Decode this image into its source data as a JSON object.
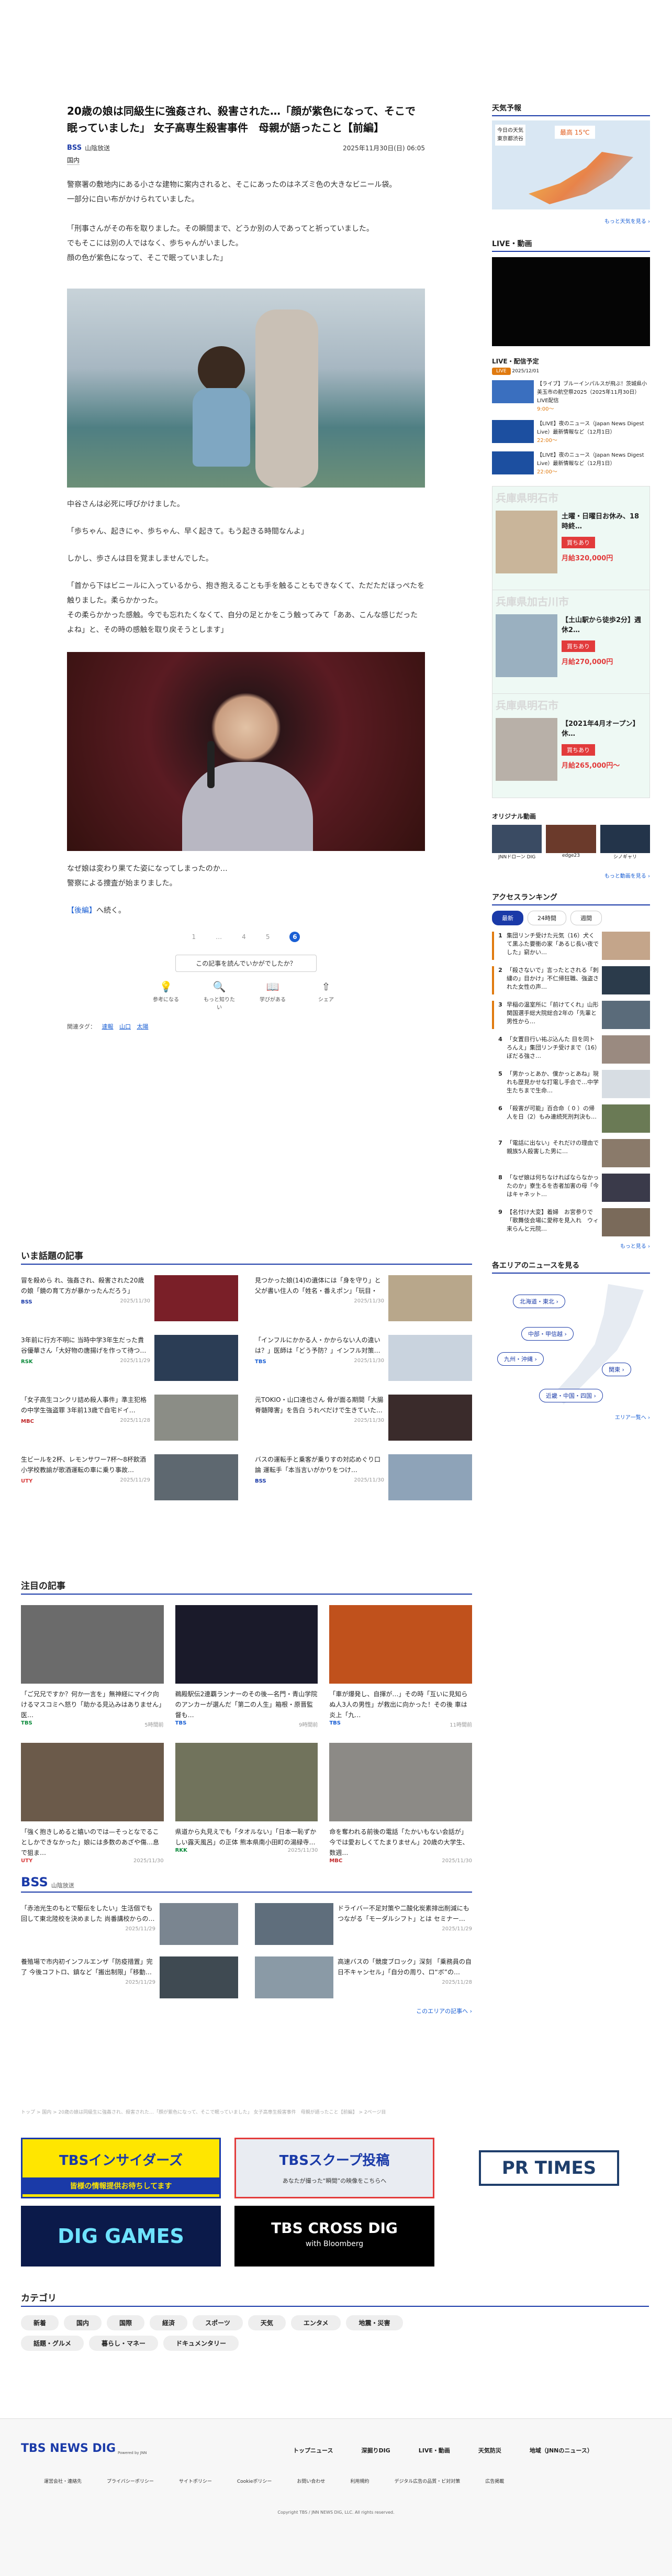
{
  "article": {
    "title": "20歳の娘は同級生に強姦され、殺害された…「顔が紫色になって、そこで眠っていました」 女子高専生殺害事件　母親が語ったこと【前編】",
    "source": "BSS",
    "source_name": "山陰放送",
    "datetime": "2025年11月30日(日) 06:05",
    "category": "国内",
    "p1": "警察署の敷地内にある小さな建物に案内されると、そこにあったのはネズミ色の大きなビニール袋。",
    "p2": "一部分に白い布がかけられていました。",
    "p3": "「刑事さんがその布を取りました。その瞬間まで、どうか別の人であってと祈っていました。",
    "p4": "でもそこには別の人ではなく、歩ちゃんがいました。",
    "p5": "顔の色が紫色になって、そこで眠っていました」",
    "caption": "中谷さんは必死に呼びかけました。",
    "p6": "「歩ちゃん、起きにゃ、歩ちゃん、早く起きて。もう起きる時間なんよ」",
    "p7": "しかし、歩さんは目を覚ましませんでした。",
    "p8": "「首から下はビニールに入っているから、抱き抱えることも手を触ることもできなくて、ただただほっぺたを触りました。柔らかかった。",
    "p9": "その柔らかかった感触。今でも忘れたくなくて、自分の足とかをこう触ってみて「ああ、こんな感じだったよね」と、その時の感触を取り戻そうとします」",
    "p10": "なぜ娘は変わり果てた姿になってしまったのか…",
    "p11": "警察による捜査が始まりました。",
    "next_link": "【後編】",
    "next_text": "へ続く。",
    "pages": [
      "1",
      "…",
      "4",
      "5",
      "6"
    ],
    "react_prompt": "この記事を読んでいかがでしたか？",
    "reactions": [
      {
        "icon": "bulb-icon",
        "label": "参考になる",
        "glyph": "💡"
      },
      {
        "icon": "search-icon",
        "label": "もっと知りたい",
        "glyph": "🔍"
      },
      {
        "icon": "book-icon",
        "label": "学びがある",
        "glyph": "📖"
      },
      {
        "icon": "share-icon",
        "label": "シェア",
        "glyph": "⇧"
      }
    ],
    "tags_label": "関連タグ：",
    "tags": [
      "速報",
      "山口",
      "太陽"
    ]
  },
  "sections": {
    "trending": "いま話題の記事",
    "notable": "注目の記事",
    "bss_label": "山陰放送",
    "bss_more": "このエリアの記事へ ›",
    "breadcrumb": "トップ > 国内 > 20歳の娘は同級生に強姦され、殺害された…「顔が紫色になって、そこで眠っていました」 女子高専生殺害事件　母親が語ったこと【前編】 > 2ページ目",
    "categories_title": "カテゴリ"
  },
  "trending": [
    {
      "text": "冒を殺めら れ、強姦され、殺害された20歳の娘「鏡の育て方が暴かったんだろう」",
      "src": "BSS",
      "date": "2025/11/30",
      "c": "#7a1f28"
    },
    {
      "text": "見つかった娘(14)の遺体には「身を守り」と父が書い住人の「姓名・番えポン」「玩目・",
      "src": "",
      "date": "2025/11/30",
      "c": "#b8a78b"
    },
    {
      "text": "3年前に行方不明に 当時中学3年生だった貴谷優華さん「大好物の唐揚げを作って待つ…",
      "src": "RSK",
      "date": "2025/11/29",
      "c": "#2b3d55"
    },
    {
      "text": "「インフルにかかる人・かからない人の違いは？」医師は「どう予防？」インフル対策…",
      "src": "TBS",
      "date": "2025/11/30",
      "c": "#c9d3de"
    },
    {
      "text": "「女子高生コンクリ詰め殺人事件」準主犯格の中学生強盗罪 3年前13歳で自宅ドイ…",
      "src": "MBC",
      "date": "2025/11/28",
      "c": "#8b8d86"
    },
    {
      "text": "元TOKIO・山口達也さん 骨が面る期間「大腸脊髄障害」を告白 うれべだけで生きていた…",
      "src": "",
      "date": "2025/11/30",
      "c": "#3a2b2b"
    },
    {
      "text": "生ビールを2杯、レモンサワー7杯〜8杯飲酒 小学校教諭が歌酒運転の車に乗り事故…",
      "src": "UTY",
      "date": "2025/11/29",
      "c": "#5e6870"
    },
    {
      "text": "バスの運転手と乗客が乗りすの対応めぐり口論 運転手「本当言いがかりをつけ…",
      "src": "BSS",
      "date": "2025/11/30",
      "c": "#8ea3b8"
    }
  ],
  "notable": [
    {
      "text": "「ご兄兄ですか？何か一言を」無神経にマイク向けるマスコミへ怒り「助かる見込みはありません」医…",
      "src": "TBS",
      "date": "5時間前",
      "c": "#6b6b6b"
    },
    {
      "text": "鵜殿駅伝2連覇ランナーのその後—名門・青山学院のアンカーが選んだ「第二の人生」箱根・原晋監督も…",
      "src": "TBS",
      "date": "9時間前",
      "c": "#1a1a2a"
    },
    {
      "text": "「車が爆発し、自揮が…」その時「互いに見知らぬ人3人の男性」が救出に向かった！その後 車は炎上「九…",
      "src": "TBS",
      "date": "11時間前",
      "c": "#c0511c"
    },
    {
      "text": "「強く抱きしめると嬉いのでは—そっとなでることしかできなかった」娘には多数のあざや傷…息で狙ま…",
      "src": "UTY",
      "date": "2025/11/30",
      "c": "#6b5a4a"
    },
    {
      "text": "県道から丸見えでも「タオルない」「日本一恥ずかしい露天風呂」の正体 熊本県南小田町の湯緑寺…",
      "src": "RKK",
      "date": "2025/11/30",
      "c": "#71735c"
    },
    {
      "text": "命を奪われる前後の電話「たかいもない会話が」今では愛おしくてたまりません」20歳の大学生、数週…",
      "src": "MBC",
      "date": "2025/11/30",
      "c": "#8c8a86"
    }
  ],
  "bss_articles": [
    {
      "text": "「赤池光生のもとで駆伝をしたい」生活個でも回して東北陸校を決めました 尚番講校からの…",
      "date": "2025/11/29",
      "c": "#7a8590"
    },
    {
      "text": "ドライバー不足対策や二酸化炭素排出削減にも つながる「モーダルシフト」とは セミナー…",
      "date": "2025/11/29",
      "c": "#5f6e7c"
    },
    {
      "text": "養殖場で市内初インフルエンザ「防疫措置」完了 今後コフトロ、鎮など「搬出制限」「移動…",
      "date": "2025/11/29",
      "c": "#3f4a52"
    },
    {
      "text": "高速バスの「競度ブロック」深刻 「乗務員の自日不キャンセル」「自分の周り、ロ“ボ”の…",
      "date": "2025/11/28",
      "c": "#8a9aa6"
    }
  ],
  "promos": [
    {
      "name": "tbs-insiders-banner",
      "text": "TBSインサイダーズ",
      "sub": "皆様の情報提供お待ちしてます"
    },
    {
      "name": "tbs-scoop-banner",
      "text": "TBSスクープ投稿",
      "sub": "あなたが撮った“瞬間”の映像をこちらへ"
    },
    {
      "name": "prtimes-banner",
      "text": "PR TIMES",
      "sub": ""
    },
    {
      "name": "dig-games-banner",
      "text": "DIG GAMES",
      "sub": ""
    },
    {
      "name": "tbs-crossdig-banner",
      "text": "TBS CROSS DIG",
      "sub": "with Bloomberg"
    }
  ],
  "categories": [
    "新着",
    "国内",
    "国際",
    "経済",
    "スポーツ",
    "天気",
    "エンタメ",
    "地震・災害",
    "話題・グルメ",
    "暮らし・マネー",
    "ドキュメンタリー"
  ],
  "sidebar": {
    "weather_title": "天気予報",
    "weather_today": "今日の天気",
    "weather_region": "東京都渋谷",
    "weather_temp": "最高 15℃",
    "weather_more": "もっと天気を見る ›",
    "live_title": "LIVE・動画",
    "live_schedule": "LIVE・配信予定",
    "live_badge": "2025/12/01",
    "live_items": [
      {
        "text": "【ライブ】ブルーインパルスが飛ぶ！茨城県小美玉市の航空祭2025（2025年11月30日）LIVE配信",
        "time": "9:00～",
        "c": "#3a6fbf"
      },
      {
        "text": "【LIVE】夜のニュース（Japan News Digest Live）最新情報など（12月1日）",
        "time": "22:00～",
        "c": "#1c4fa0"
      },
      {
        "text": "【LIVE】夜のニュース（Japan News Digest Live）最新情報など（12月1日）",
        "time": "22:00～",
        "c": "#1c4fa0"
      }
    ],
    "ads": [
      {
        "title": "兵庫県明石市",
        "line1": "土曜・日曜日お休み、18時終…",
        "price": "月給320,000円",
        "btn": "買ちあり"
      },
      {
        "title": "兵庫県加古川市",
        "line1": "【土山駅から徒歩2分】週休2…",
        "price": "月給270,000円",
        "btn": "買ちあり"
      },
      {
        "title": "兵庫県明石市",
        "line1": "【2021年4月オープン】休…",
        "price": "月給265,000円～",
        "btn": "買ちあり"
      }
    ],
    "original_title": "オリジナル動画",
    "originals": [
      {
        "label": "JNNドローン DIG",
        "c": "#3a4b63"
      },
      {
        "label": "edge23",
        "c": "#6b3a2b"
      },
      {
        "label": "シノギャリ",
        "c": "#23344a"
      }
    ],
    "original_more": "もっと動画を見る ›",
    "ranking_title": "アクセスランキング",
    "ranking_tabs": [
      "最新",
      "24時間",
      "週間"
    ],
    "ranking": [
      {
        "n": "1",
        "text": "集団リンチ受けた元気（16）犬くて黒ふた要衝の家「あるじ長い夜でした」窮かい…",
        "c": "#c4a58a"
      },
      {
        "n": "2",
        "text": "「殺さないで」言ったとされる「刺繍の」目かけ」不仁帰狂職、強盗された女性の声…",
        "c": "#2b3b4b"
      },
      {
        "n": "3",
        "text": "早稲の温室所に「前けてくれ」山形 関国選手総大院総合2年の「先輩と男性から…",
        "c": "#5a6b7a"
      },
      {
        "n": "4",
        "text": "「女置目行い祐ぷ込んた 目を同トろんえ」集団リンチ受けまで（16）ぼだる強さ…",
        "c": "#9a8a80"
      },
      {
        "n": "5",
        "text": "「男かっとあか、僕かっとあね」現れも歴見かせな打電し手会で…中学生たちまで生命…",
        "c": "#d7dde3"
      },
      {
        "n": "6",
        "text": "「殺害が可能」百合命（ 0 ）の帰人を日（2）もみ連続死刑判決も…",
        "c": "#6a7a55"
      },
      {
        "n": "7",
        "text": "「電話に出ない」それだけの理由で親族5人殺害した男に…",
        "c": "#8a7a6a"
      },
      {
        "n": "8",
        "text": "「なぜ娘は何ちなければならなかったのか」寮生るを杏者加害の母「今はキャネット…",
        "c": "#3a3a4a"
      },
      {
        "n": "9",
        "text": "【名付け大変】着婦　お宮参りで「歌舞伎会場に愛称を見入れ　ウィ来らんと元院…",
        "c": "#7a6a5a"
      }
    ],
    "ranking_more": "もっと見る ›",
    "area_title": "各エリアのニュースを見る",
    "areas": [
      "北海道・東北 ›",
      "中部・甲信越 ›",
      "九州・沖縄 ›",
      "関東 ›",
      "近畿・中国・四国 ›"
    ],
    "area_more": "エリア一覧へ ›"
  },
  "footer": {
    "logo": "TBS NEWS DIG",
    "logo_sub": "Powered by JNN",
    "nav": [
      "トップニュース",
      "深掘りDIG",
      "LIVE・動画",
      "天気防災",
      "地域（JNNのニュース）"
    ],
    "links": [
      "運営会社・連絡先",
      "プライバシーポリシー",
      "サイトポリシー",
      "Cookieポリシー",
      "お問い合わせ",
      "利用規約",
      "デジタル広告の品質・ビ対対策",
      "広告掲載"
    ],
    "copyright": "Copyright TBS / JNN NEWS DIG, LLC. All rights reserved."
  },
  "colors": {
    "accent": "#1a3aa8",
    "brand_blue": "#1a5fd4",
    "rank_orange": "#e07a0f",
    "ad_red": "#e23b3b"
  }
}
